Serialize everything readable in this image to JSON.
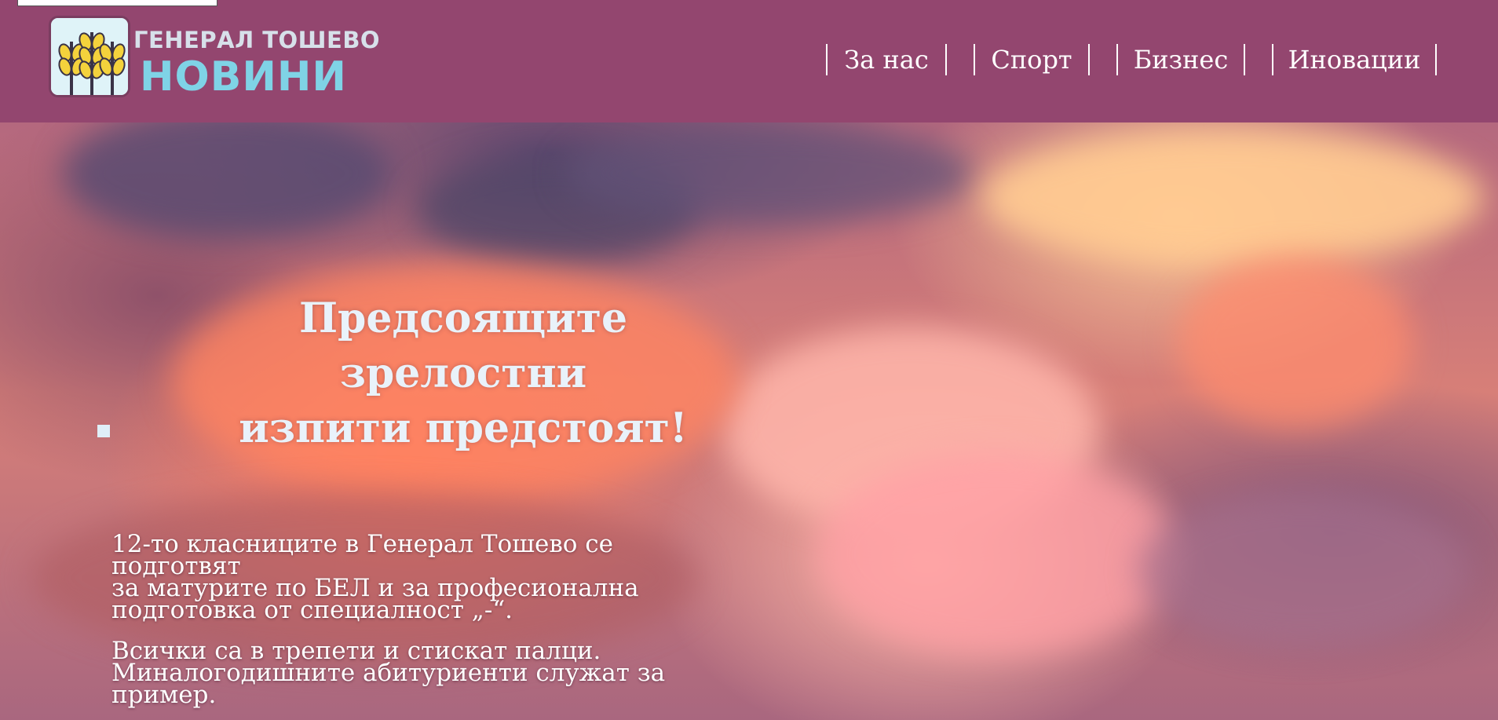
{
  "logo": {
    "line1": "ГЕНЕРАЛ ТОШЕВО",
    "line2": "НОВИНИ",
    "icon": "wheat-icon"
  },
  "nav": {
    "items": [
      {
        "label": "За нас"
      },
      {
        "label": "Спорт"
      },
      {
        "label": "Бизнес"
      },
      {
        "label": "Иновации"
      }
    ]
  },
  "hero": {
    "title_line1": "Предсоящите зрелостни",
    "title_line2": "изпити предстоят!",
    "paragraph1_line1": "12-то класниците в Генерал Тошево се подготвят",
    "paragraph1_line2": "за матурите по БЕЛ и за професионална",
    "paragraph1_line3": "подготовка от специалност „-“.",
    "paragraph2_line1": "Всички са в трепети и стискат палци.",
    "paragraph2_line2": "Миналогодишните абитуриенти служат за",
    "paragraph2_line3": "пример."
  },
  "colors": {
    "header": "#93466f",
    "logo_text_top": "#d7e0ea",
    "logo_text_bottom": "#7fd3e6",
    "nav_text": "#ffffff",
    "hero_title": "#e9f2fa"
  }
}
